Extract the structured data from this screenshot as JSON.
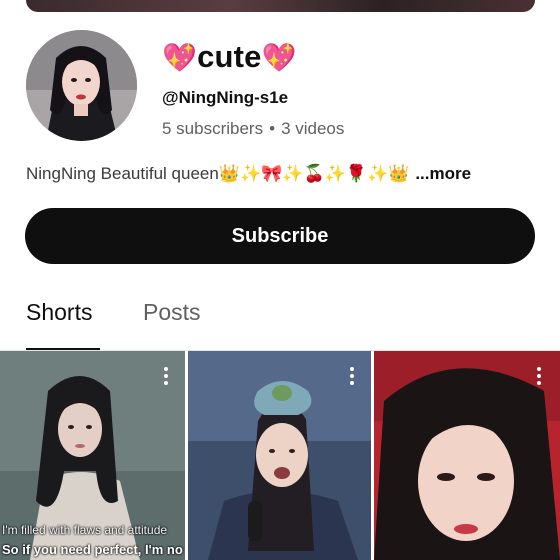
{
  "channel": {
    "name_prefix_emoji": "💖",
    "name": "cute",
    "name_suffix_emoji": "💖",
    "handle": "@NingNing-s1e",
    "subscribers": "5 subscribers",
    "separator": "•",
    "videos": "3 videos",
    "description": "NingNing Beautiful queen👑✨🎀✨🍒✨🌹✨👑",
    "description_more": "...more"
  },
  "subscribe_button": {
    "label": "Subscribe"
  },
  "tabs": [
    {
      "label": "Shorts",
      "active": true
    },
    {
      "label": "Posts",
      "active": false
    }
  ],
  "shorts": [
    {
      "caption_line1": "I'm filled with flaws and attitude",
      "caption_line2": "So if you need perfect, I'm no"
    },
    {
      "caption_line1": "",
      "caption_line2": ""
    },
    {
      "caption_line1": "",
      "caption_line2": ""
    }
  ],
  "icons": {
    "more": "more-vert-icon"
  },
  "colors": {
    "button_bg": "#0f0f0f",
    "text_primary": "#0f0f0f",
    "text_secondary": "#606060"
  }
}
